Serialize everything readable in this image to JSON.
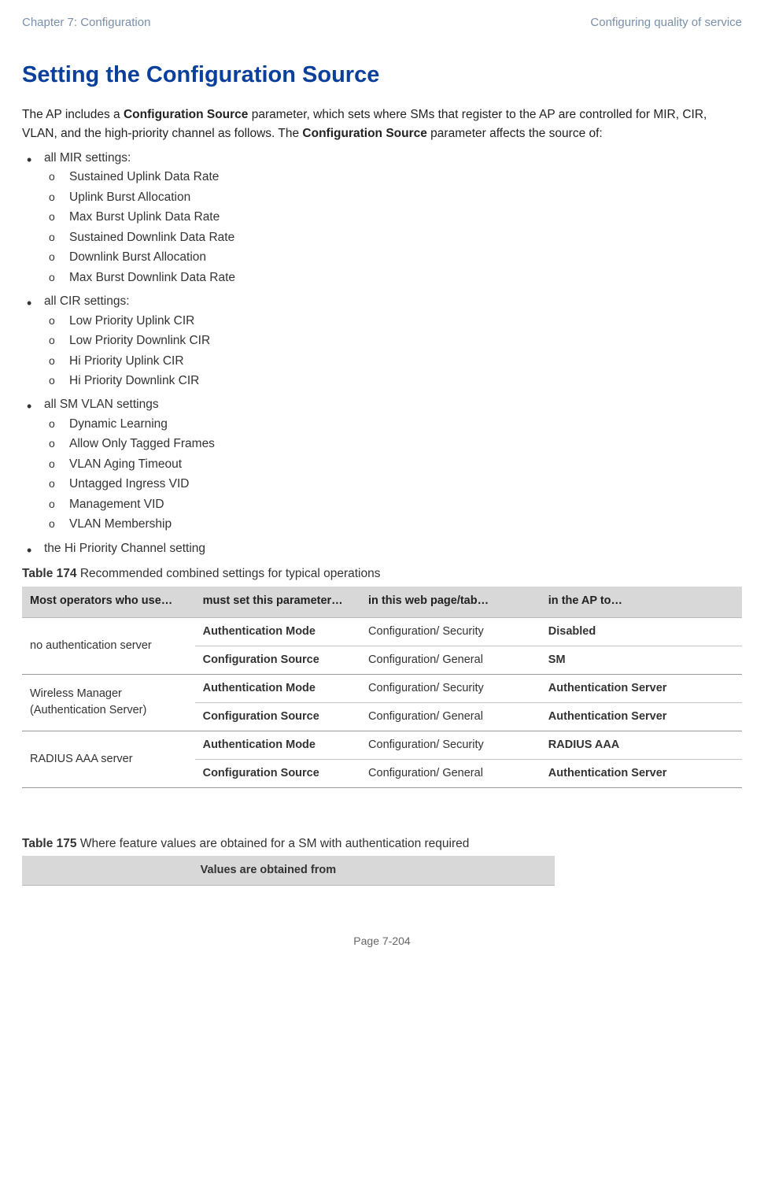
{
  "header": {
    "left": "Chapter 7:  Configuration",
    "right": "Configuring quality of service"
  },
  "title": "Setting the Configuration Source",
  "intro": {
    "p1a": "The AP includes a ",
    "p1b_bold": "Configuration Source",
    "p1c": " parameter, which sets where SMs that register to the AP are controlled for MIR, CIR, VLAN, and the high-priority channel as follows. The ",
    "p1d_bold": "Configuration Source",
    "p1e": " parameter affects the source of:"
  },
  "bullets": [
    {
      "label": "all MIR settings:",
      "items": [
        "Sustained Uplink Data Rate",
        "Uplink Burst Allocation",
        "Max Burst Uplink Data Rate",
        "Sustained Downlink Data Rate",
        "Downlink Burst Allocation",
        "Max Burst Downlink Data Rate"
      ]
    },
    {
      "label": "all CIR settings:",
      "items": [
        "Low Priority Uplink CIR",
        "Low Priority Downlink CIR",
        "Hi Priority Uplink CIR",
        "Hi Priority Downlink CIR"
      ]
    },
    {
      "label": "all SM VLAN settings",
      "items": [
        "Dynamic Learning",
        "Allow Only Tagged Frames",
        "VLAN Aging Timeout",
        "Untagged Ingress VID",
        "Management VID",
        "VLAN Membership"
      ]
    },
    {
      "label": "the Hi Priority Channel setting",
      "items": []
    }
  ],
  "table174": {
    "caption_bold": "Table 174",
    "caption_rest": " Recommended combined settings for typical operations",
    "headers": [
      "Most operators who use…",
      "must set this parameter…",
      "in this web page/tab…",
      "in the AP to…"
    ],
    "groups": [
      {
        "operator": "no authentication server",
        "rows": [
          {
            "param": "Authentication Mode",
            "page": "Configuration/ Security",
            "apto": "Disabled"
          },
          {
            "param": "Configuration Source",
            "page": "Configuration/ General",
            "apto": "SM"
          }
        ]
      },
      {
        "operator": "Wireless Manager (Authentication Server)",
        "rows": [
          {
            "param": "Authentication Mode",
            "page": "Configuration/ Security",
            "apto": "Authentication Server"
          },
          {
            "param": "Configuration Source",
            "page": "Configuration/ General",
            "apto": "Authentication Server"
          }
        ]
      },
      {
        "operator": "RADIUS AAA server",
        "rows": [
          {
            "param": "Authentication Mode",
            "page": "Configuration/ Security",
            "apto": "RADIUS AAA"
          },
          {
            "param": "Configuration Source",
            "page": "Configuration/ General",
            "apto": "Authentication Server"
          }
        ]
      }
    ]
  },
  "table175": {
    "caption_bold": "Table 175",
    "caption_rest": " Where feature values are obtained for a SM with authentication required",
    "headers": [
      "",
      "Values are obtained from"
    ]
  },
  "footer": "Page 7-204"
}
